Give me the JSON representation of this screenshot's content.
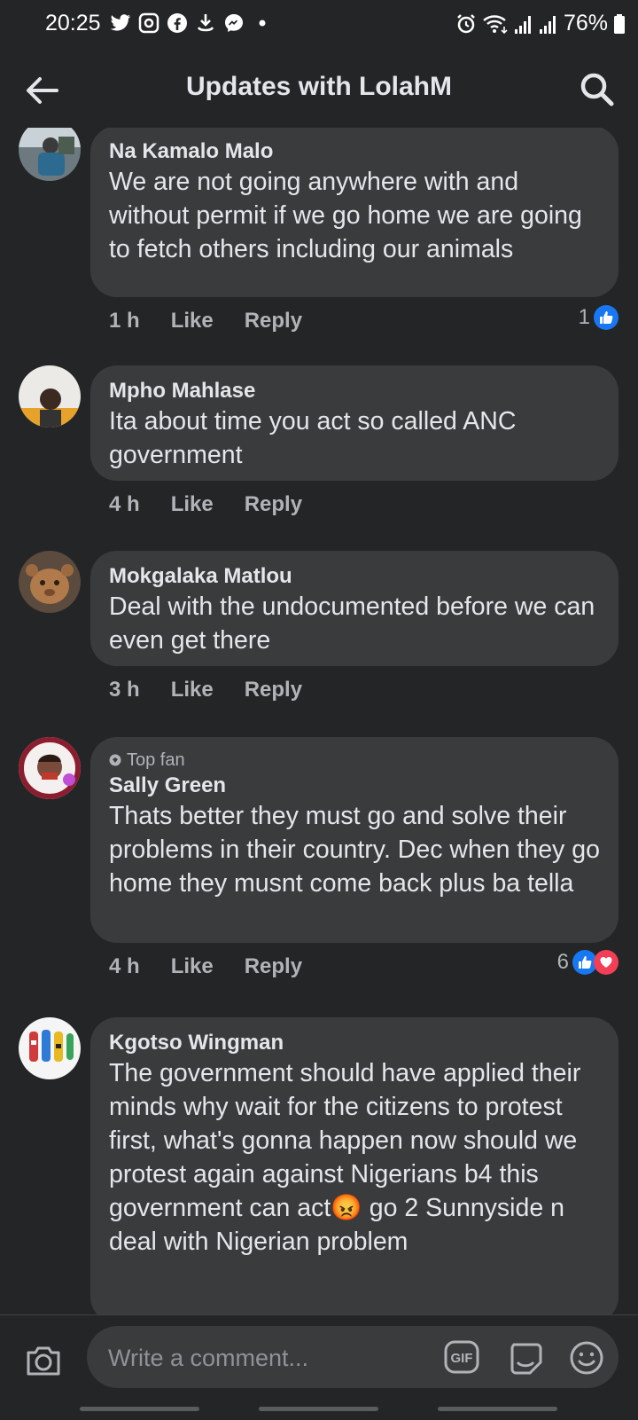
{
  "status_bar": {
    "time": "20:25",
    "battery": "76%"
  },
  "header": {
    "title": "Updates with LolahM"
  },
  "comments": [
    {
      "author": "Na Kamalo Malo",
      "text": "We are not going anywhere with and without permit if we go home we are going to fetch others including our animals",
      "time": "1 h",
      "like": "Like",
      "reply": "Reply",
      "reaction_count": "1"
    },
    {
      "author": "Mpho Mahlase",
      "text": "Ita about time you act so called ANC government",
      "time": "4 h",
      "like": "Like",
      "reply": "Reply"
    },
    {
      "author": "Mokgalaka Matlou",
      "text": "Deal with the undocumented before we can even get there",
      "time": "3 h",
      "like": "Like",
      "reply": "Reply"
    },
    {
      "badge": "Top fan",
      "author": "Sally Green",
      "text": "Thats better they must go and solve their problems in their country. Dec when they go home they musnt come back plus ba tella",
      "time": "4 h",
      "like": "Like",
      "reply": "Reply",
      "reaction_count": "6"
    },
    {
      "author": "Kgotso Wingman",
      "text": "The government should have applied their minds why wait for the citizens to protest first, what's gonna happen now should we protest again against Nigerians b4 this government can act",
      "emoji": "😡",
      "text_after": "go 2 Sunnyside n deal with Nigerian problem"
    }
  ],
  "composer": {
    "placeholder": "Write a comment...",
    "gif_label": "GIF"
  },
  "colors": {
    "background": "#242526",
    "bubble": "#3a3b3c",
    "like_blue": "#1877f2",
    "love_red": "#f33e58"
  }
}
